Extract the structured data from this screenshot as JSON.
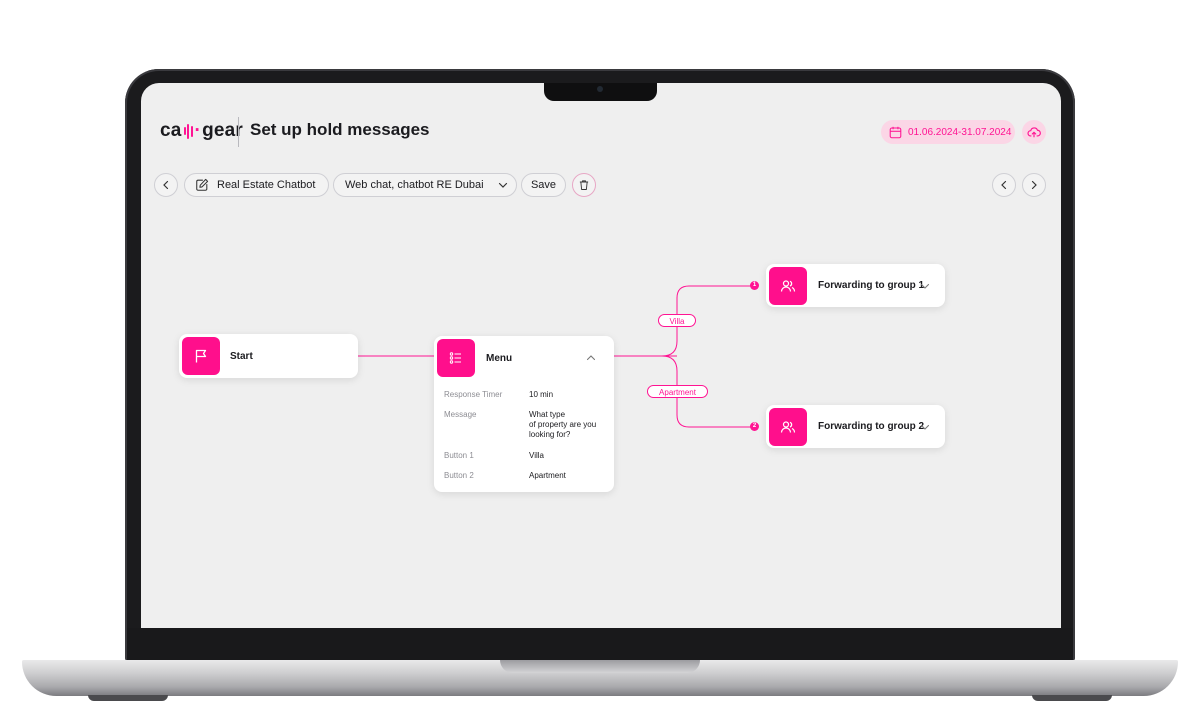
{
  "header": {
    "logo_left": "ca",
    "logo_right": "gear",
    "title": "Set up hold messages",
    "date_range": "01.06.2024-31.07.2024"
  },
  "toolbar": {
    "chatbot_name": "Real Estate Chatbot",
    "channel": "Web chat, chatbot RE Dubai",
    "save_label": "Save"
  },
  "flow": {
    "start": {
      "label": "Start"
    },
    "menu": {
      "label": "Menu",
      "rows": [
        {
          "key": "Response Timer",
          "value": "10 min"
        },
        {
          "key": "Message",
          "value": "What type\nof property are you\nlooking for?"
        },
        {
          "key": "Button 1",
          "value": "Villa"
        },
        {
          "key": "Button 2",
          "value": "Apartment"
        }
      ]
    },
    "edges": [
      {
        "label": "Villa",
        "port": "1"
      },
      {
        "label": "Apartment",
        "port": "2"
      }
    ],
    "targets": [
      {
        "label": "Forwarding to group 1"
      },
      {
        "label": "Forwarding to group 2"
      }
    ]
  },
  "colors": {
    "accent": "#ff1493",
    "accent_soft": "#fbd6e6",
    "canvas_bg": "#efefef"
  },
  "icons": [
    "calendar-icon",
    "upload-cloud-icon",
    "chevron-left-icon",
    "chevron-right-icon",
    "edit-icon",
    "chevron-down-icon",
    "trash-icon",
    "flag-icon",
    "menu-list-icon",
    "chevron-up-icon",
    "users-icon"
  ]
}
